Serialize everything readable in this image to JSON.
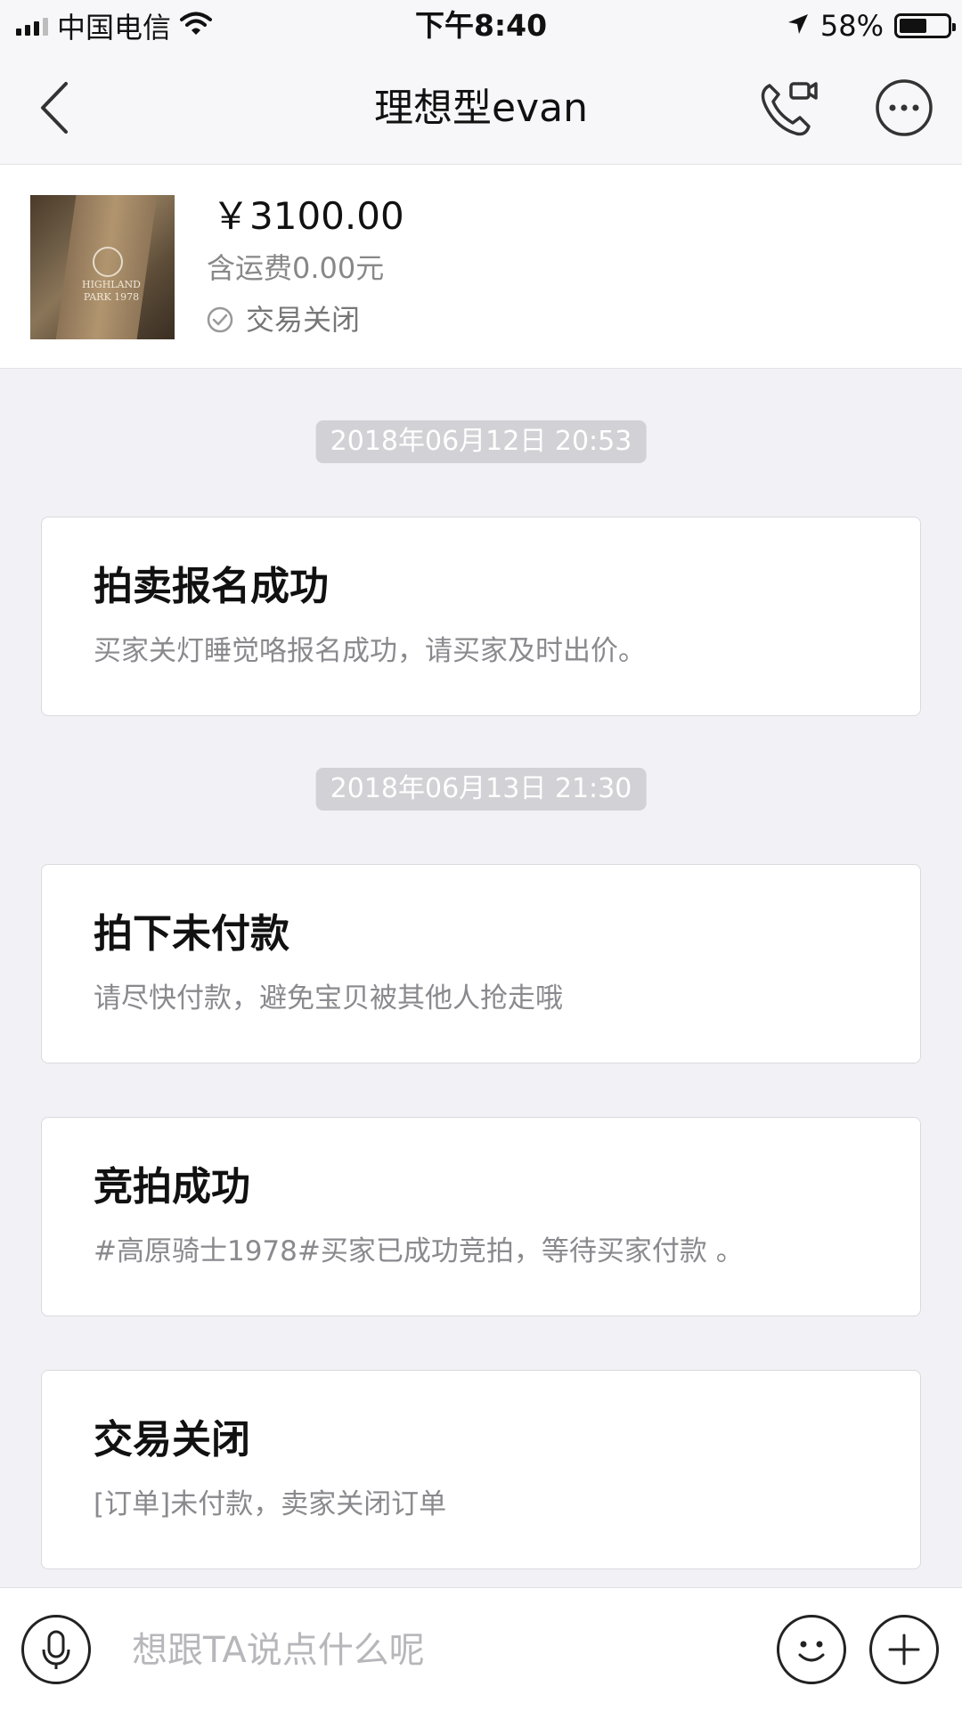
{
  "status_bar": {
    "carrier": "中国电信",
    "time": "下午8:40",
    "battery_percent": "58%",
    "battery_level": 0.58,
    "icons": [
      "signal-icon",
      "wifi-icon",
      "location-arrow-icon",
      "battery-icon"
    ]
  },
  "nav": {
    "title": "理想型evan",
    "icons": [
      "back-chevron-icon",
      "video-call-icon",
      "more-dots-icon"
    ]
  },
  "product": {
    "price": "￥3100.00",
    "shipping": "含运费0.00元",
    "status": "交易关闭",
    "thumb_text": "HIGHLAND PARK 1978",
    "icons": [
      "check-circle-icon"
    ]
  },
  "timeline": [
    {
      "type": "time",
      "text": "2018年06月12日  20:53"
    },
    {
      "type": "card",
      "title": "拍卖报名成功",
      "body": "买家关灯睡觉咯报名成功，请买家及时出价。"
    },
    {
      "type": "time",
      "text": "2018年06月13日  21:30"
    },
    {
      "type": "card",
      "title": "拍下未付款",
      "body": "请尽快付款，避免宝贝被其他人抢走哦"
    },
    {
      "type": "card",
      "title": "竞拍成功",
      "body": "#高原骑士1978#买家已成功竞拍，等待买家付款 。"
    },
    {
      "type": "card",
      "title": "交易关闭",
      "body": "[订单]未付款，卖家关闭订单"
    }
  ],
  "input_bar": {
    "placeholder": "想跟TA说点什么呢",
    "icons": [
      "microphone-icon",
      "emoji-icon",
      "plus-icon"
    ]
  },
  "colors": {
    "page_bg": "#f2f2f6",
    "time_chip_bg": "#d2d2d6",
    "secondary_text": "#8a8a8e",
    "placeholder": "#b7b7bb"
  }
}
